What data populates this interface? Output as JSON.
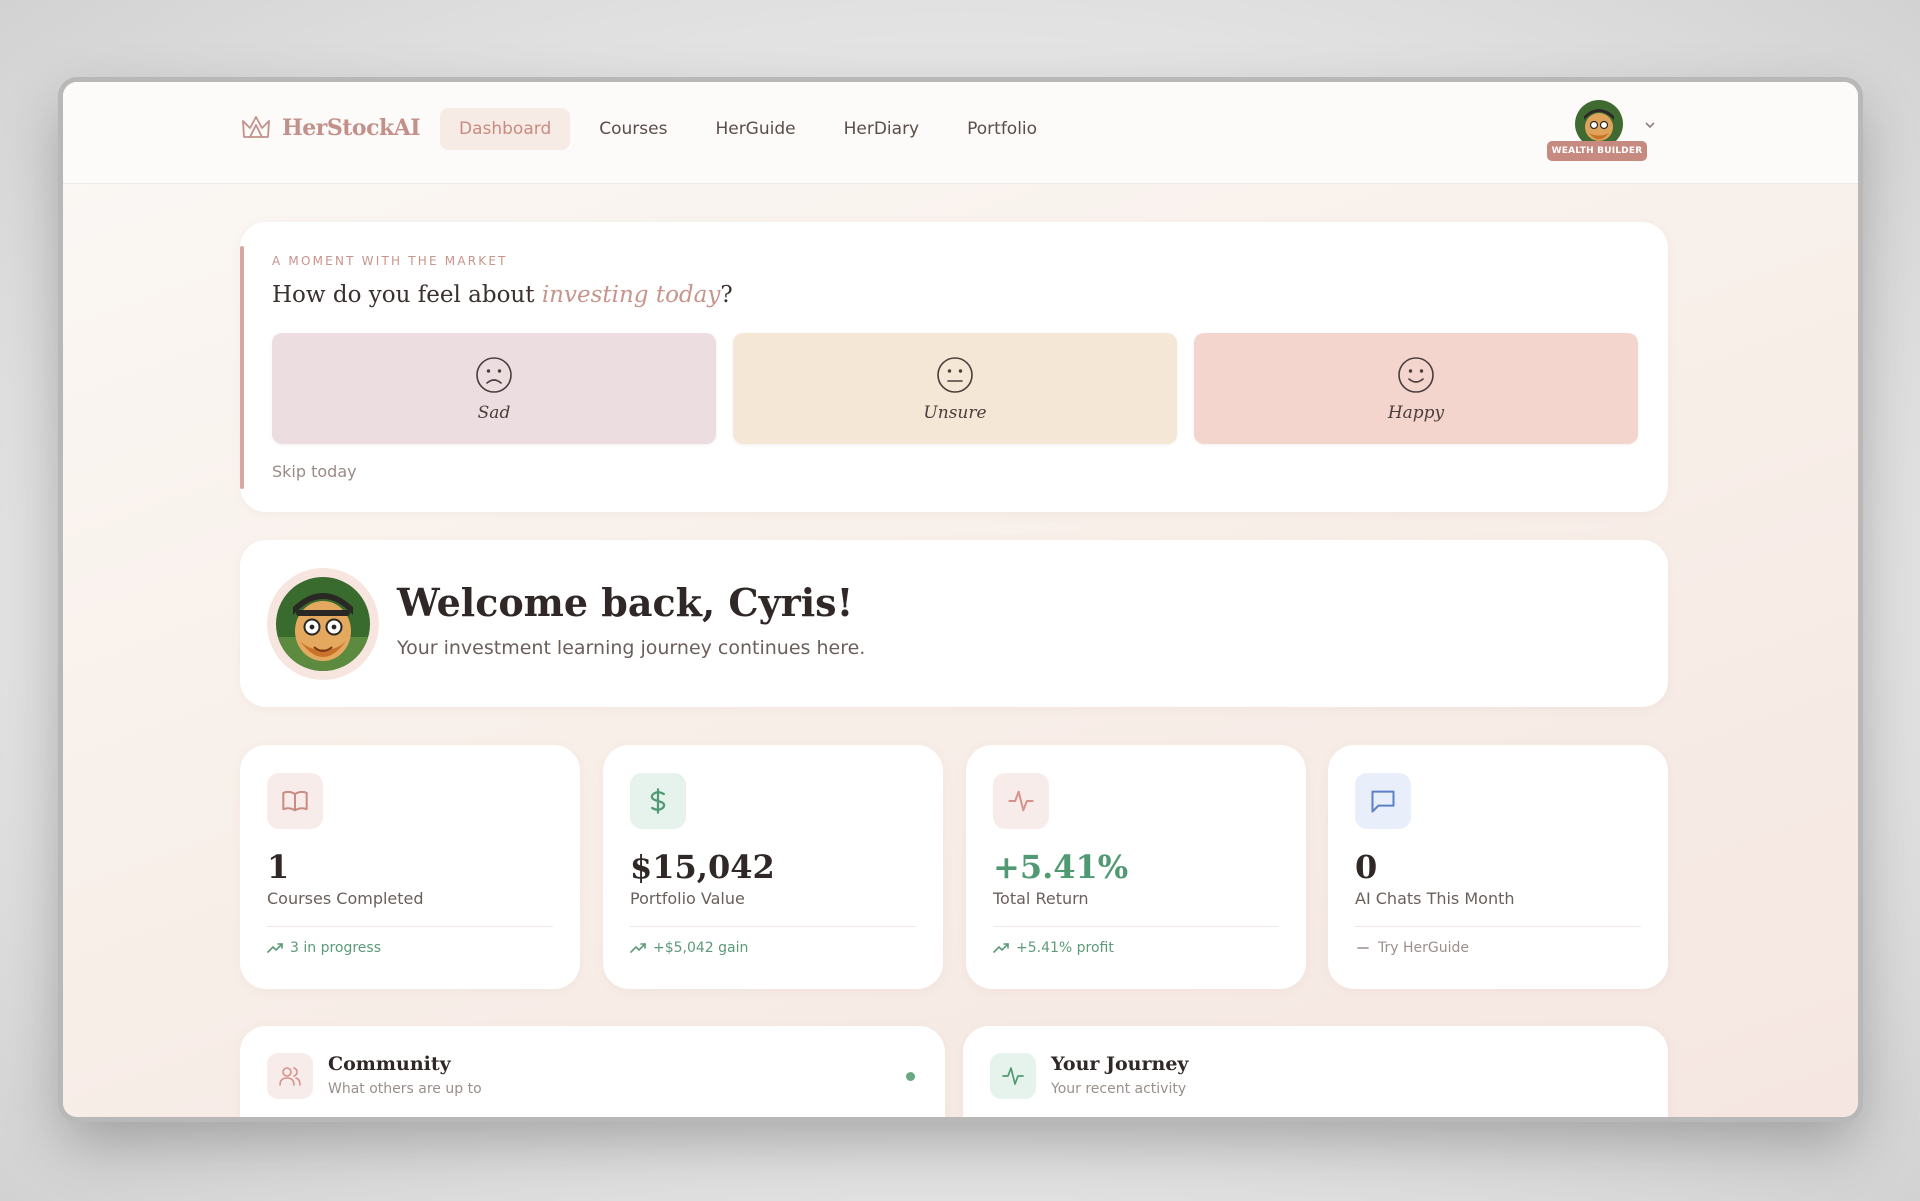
{
  "app": {
    "brand": "HerStockAI",
    "nav": [
      {
        "label": "Dashboard",
        "active": true
      },
      {
        "label": "Courses",
        "active": false
      },
      {
        "label": "HerGuide",
        "active": false
      },
      {
        "label": "HerDiary",
        "active": false
      },
      {
        "label": "Portfolio",
        "active": false
      }
    ],
    "profile": {
      "badge": "WEALTH BUILDER",
      "icon": "chevron-down-icon"
    }
  },
  "mood_check": {
    "eyebrow": "A MOMENT WITH THE MARKET",
    "question_prefix": "How do you feel about ",
    "question_emphasis": "investing today",
    "question_suffix": "?",
    "options": [
      {
        "label": "Sad",
        "icon": "sad-face-icon",
        "color": "#ecdde0"
      },
      {
        "label": "Unsure",
        "icon": "neutral-face-icon",
        "color": "#f5e7d5"
      },
      {
        "label": "Happy",
        "icon": "happy-face-icon",
        "color": "#f4d5ce"
      }
    ],
    "skip": "Skip today"
  },
  "welcome": {
    "title": "Welcome back, Cyris!",
    "subtitle": "Your investment learning journey continues here."
  },
  "stats": [
    {
      "value": "1",
      "label": "Courses Completed",
      "footer": "3 in progress",
      "icon": "book-icon",
      "footer_icon": "trending-up-icon",
      "accent": "#c88c80"
    },
    {
      "value": "$15,042",
      "label": "Portfolio Value",
      "footer": "+$5,042 gain",
      "icon": "dollar-icon",
      "footer_icon": "trending-up-icon",
      "accent": "#4f9a72"
    },
    {
      "value": "+5.41%",
      "label": "Total Return",
      "footer": "+5.41% profit",
      "icon": "activity-icon",
      "footer_icon": "trending-up-icon",
      "accent": "#4f9a72"
    },
    {
      "value": "0",
      "label": "AI Chats This Month",
      "footer": "Try HerGuide",
      "icon": "chat-icon",
      "footer_icon": "minus-icon",
      "accent": "#5b7fc8"
    }
  ],
  "panels": [
    {
      "title": "Community",
      "subtitle": "What others are up to",
      "icon": "users-icon",
      "status": "online"
    },
    {
      "title": "Your Journey",
      "subtitle": "Your recent activity",
      "icon": "activity-icon"
    }
  ]
}
